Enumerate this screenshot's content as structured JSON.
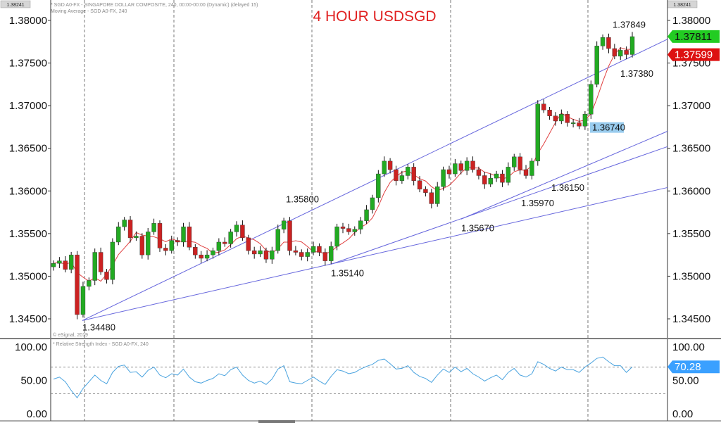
{
  "header": {
    "price_chip": "1.38241",
    "info_line": "* SGD A0-FX - SINGAPORE DOLLAR COMPOSITE, 240, 00:00-00:00 (Dynamic) (delayed 15)",
    "ma_line": "Moving Average - SGD A0-FX, 240",
    "title": "4 HOUR USDSGD"
  },
  "watermark": "© eSignal, 2019",
  "rsi_info": "* Relative Strength Index - SGD A0-FX, 240",
  "colors": {
    "up": "#22aa22",
    "down": "#cc2222",
    "wick": "#111111",
    "ma": "#e04040",
    "trend": "#6666dd",
    "rsi": "#4aa3df",
    "title": "#e02020",
    "last_tag": "#22cc22",
    "ma_tag": "#dd1111",
    "rsi_tag": "#3aa0ff",
    "support_tag": "#99ccee"
  },
  "chart_data": [
    {
      "type": "candlestick",
      "title": "4 HOUR USDSGD",
      "y_ticks": [
        "1.38000",
        "1.37500",
        "1.37000",
        "1.36500",
        "1.36000",
        "1.35500",
        "1.35000",
        "1.34500"
      ],
      "ylim": [
        1.3425,
        1.3825
      ],
      "grid": "vertical dashed",
      "series": [
        {
          "name": "Moving Average - SGD A0-FX, 240",
          "type": "line"
        }
      ],
      "close_path": [
        1.3515,
        1.3518,
        1.3508,
        1.3525,
        1.3455,
        1.3488,
        1.3495,
        1.3528,
        1.3505,
        1.3496,
        1.354,
        1.3558,
        1.3566,
        1.3545,
        1.3547,
        1.3525,
        1.3552,
        1.3562,
        1.3533,
        1.353,
        1.3542,
        1.354,
        1.3558,
        1.3534,
        1.3525,
        1.3521,
        1.3525,
        1.353,
        1.354,
        1.3538,
        1.3552,
        1.356,
        1.3545,
        1.353,
        1.3526,
        1.353,
        1.352,
        1.353,
        1.3555,
        1.3565,
        1.353,
        1.3528,
        1.3523,
        1.3528,
        1.3535,
        1.3528,
        1.3518,
        1.3535,
        1.3558,
        1.3556,
        1.3552,
        1.3555,
        1.3565,
        1.3578,
        1.3592,
        1.362,
        1.3635,
        1.3625,
        1.3612,
        1.3618,
        1.3628,
        1.3612,
        1.3602,
        1.3598,
        1.3585,
        1.3605,
        1.3625,
        1.362,
        1.3632,
        1.3624,
        1.3635,
        1.3625,
        1.3618,
        1.3608,
        1.3615,
        1.362,
        1.361,
        1.3628,
        1.364,
        1.3625,
        1.3618,
        1.3635,
        1.3702,
        1.3695,
        1.3688,
        1.3682,
        1.369,
        1.368,
        1.368,
        1.3676,
        1.369,
        1.3725,
        1.377,
        1.378,
        1.3767,
        1.3758,
        1.3765,
        1.376,
        1.3781
      ],
      "rsi": {
        "name": "Relative Strength Index - SGD A0-FX, 240",
        "ylim": [
          0,
          100
        ],
        "y_ticks": [
          "100.00",
          "50.00",
          "0.00"
        ],
        "levels": [
          70,
          30
        ],
        "values": [
          52,
          55,
          48,
          35,
          24,
          38,
          48,
          58,
          50,
          45,
          62,
          71,
          73,
          62,
          63,
          55,
          65,
          70,
          58,
          54,
          60,
          58,
          67,
          55,
          48,
          46,
          50,
          53,
          60,
          57,
          66,
          70,
          58,
          50,
          46,
          49,
          44,
          52,
          67,
          72,
          48,
          46,
          45,
          50,
          55,
          49,
          44,
          56,
          66,
          64,
          60,
          62,
          67,
          71,
          74,
          80,
          82,
          75,
          67,
          68,
          72,
          62,
          56,
          53,
          47,
          58,
          67,
          62,
          70,
          63,
          68,
          60,
          55,
          49,
          54,
          58,
          51,
          62,
          68,
          58,
          55,
          60,
          78,
          74,
          68,
          64,
          70,
          66,
          66,
          62,
          70,
          76,
          83,
          85,
          78,
          72,
          72,
          62,
          70.28
        ]
      },
      "annotations": [
        {
          "label": "1.34480",
          "value": 1.3448
        },
        {
          "label": "1.35140",
          "value": 1.3514
        },
        {
          "label": "1.35800",
          "value": 1.358
        },
        {
          "label": "1.35670",
          "value": 1.3567
        },
        {
          "label": "1.35970",
          "value": 1.3597
        },
        {
          "label": "1.36150",
          "value": 1.3615
        },
        {
          "label": "1.36740",
          "value": 1.3674
        },
        {
          "label": "1.37849",
          "value": 1.37849
        },
        {
          "label": "1.37380",
          "value": 1.3738
        }
      ],
      "price_tags": [
        {
          "label": "1.37811",
          "value": 1.37811,
          "kind": "last"
        },
        {
          "label": "1.37599",
          "value": 1.37599,
          "kind": "ma"
        }
      ],
      "rsi_tag": "70.28",
      "trendlines": [
        {
          "from": 1.3448,
          "to": 1.3604
        },
        {
          "from": 1.3514,
          "to": 1.3652
        },
        {
          "from": 1.3567,
          "to": 1.367
        },
        {
          "from": 1.3448,
          "to": 1.3778
        }
      ]
    }
  ]
}
